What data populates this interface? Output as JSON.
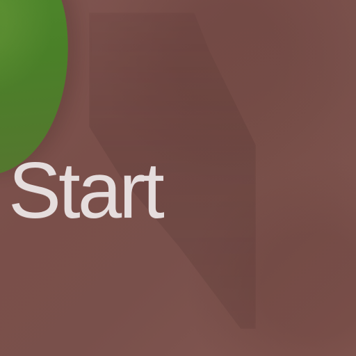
{
  "screen": {
    "start_button": {
      "label": "Start"
    }
  },
  "colors": {
    "background": "#7f5550",
    "grass": "#4f8a2d",
    "text": "#e5dddd"
  }
}
